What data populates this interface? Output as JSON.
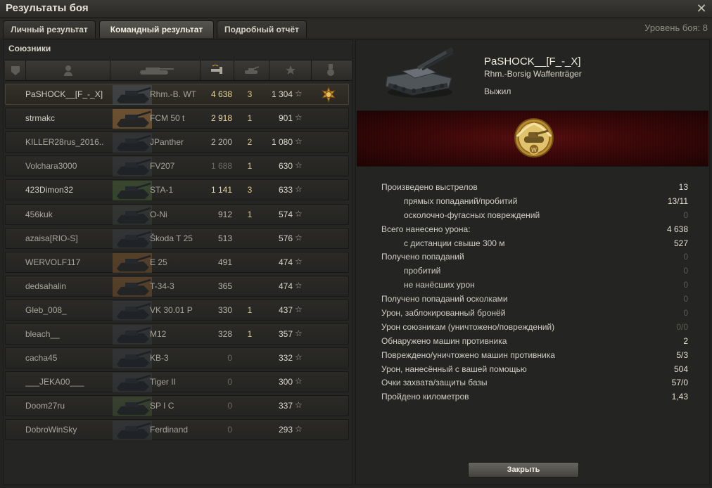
{
  "window": {
    "title": "Результаты боя",
    "close_icon": "close-icon"
  },
  "tabs": [
    {
      "label": "Личный результат",
      "active": false
    },
    {
      "label": "Командный результат",
      "active": true
    },
    {
      "label": "Подробный отчёт",
      "active": false
    }
  ],
  "battle_level": "Уровень боя: 8",
  "team": {
    "label": "Союзники",
    "header_icons": [
      "squad-icon",
      "player-icon",
      "vehicle-icon",
      "damage-icon",
      "frags-icon",
      "xp-star-icon",
      "medal-icon"
    ],
    "players": [
      {
        "name": "PaSHOCK__[F_-_X]",
        "vehicle": "Rhm.-B. WT",
        "damage": "4 638",
        "kills": "3",
        "xp": "1 304",
        "selected": true,
        "medal": true,
        "tank_color": "#525a66",
        "damage_level": "hi"
      },
      {
        "name": "strmakc",
        "vehicle": "FCM 50 t",
        "damage": "2 918",
        "kills": "1",
        "xp": "901",
        "tank_color": "#b7803f",
        "damage_level": "hi"
      },
      {
        "name": "KILLER28rus_2016..",
        "vehicle": "JPanther",
        "damage": "2 200",
        "kills": "2",
        "xp": "1 080",
        "tank_color": "#3b4048",
        "damage_level": "mid",
        "dim": true
      },
      {
        "name": "Volchara3000",
        "vehicle": "FV207",
        "damage": "1 688",
        "kills": "1",
        "xp": "630",
        "tank_color": "#3b4048",
        "damage_level": "lo",
        "dim": true
      },
      {
        "name": "423Dimon32",
        "vehicle": "STA-1",
        "damage": "1 141",
        "kills": "3",
        "xp": "633",
        "tank_color": "#4a6a3a",
        "damage_level": "hi"
      },
      {
        "name": "456kuk",
        "vehicle": "O-Ni",
        "damage": "912",
        "kills": "1",
        "xp": "574",
        "tank_color": "#3d4540",
        "damage_level": "mid",
        "dim": true
      },
      {
        "name": "azaisa[RIO-S]",
        "vehicle": "Škoda T 25",
        "damage": "513",
        "kills": "",
        "xp": "576",
        "tank_color": "#3b4048",
        "damage_level": "mid",
        "dim": true
      },
      {
        "name": "WERVOLF117",
        "vehicle": "E 25",
        "damage": "491",
        "kills": "",
        "xp": "474",
        "tank_color": "#8a5a2e",
        "damage_level": "mid",
        "dim": true
      },
      {
        "name": "dedsahalin",
        "vehicle": "T-34-3",
        "damage": "365",
        "kills": "",
        "xp": "474",
        "tank_color": "#8a5a2e",
        "damage_level": "mid",
        "dim": true
      },
      {
        "name": "Gleb_008_",
        "vehicle": "VK 30.01 P",
        "damage": "330",
        "kills": "1",
        "xp": "437",
        "tank_color": "#3b4048",
        "damage_level": "mid",
        "dim": true
      },
      {
        "name": "bleach__",
        "vehicle": "M12",
        "damage": "328",
        "kills": "1",
        "xp": "357",
        "tank_color": "#3b4048",
        "damage_level": "mid",
        "dim": true
      },
      {
        "name": "cacha45",
        "vehicle": "KB-3",
        "damage": "0",
        "kills": "",
        "xp": "332",
        "tank_color": "#3b4048",
        "damage_level": "lo",
        "dim": true
      },
      {
        "name": "___JEKA00___",
        "vehicle": "Tiger II",
        "damage": "0",
        "kills": "",
        "xp": "300",
        "tank_color": "#3b4048",
        "damage_level": "lo",
        "dim": true
      },
      {
        "name": "Doom27ru",
        "vehicle": "SP I C",
        "damage": "0",
        "kills": "",
        "xp": "337",
        "tank_color": "#4a5a3a",
        "damage_level": "lo",
        "dim": true
      },
      {
        "name": "DobroWinSky",
        "vehicle": "Ferdinand",
        "damage": "0",
        "kills": "",
        "xp": "293",
        "tank_color": "#3b4048",
        "damage_level": "lo",
        "dim": true
      }
    ]
  },
  "detail": {
    "player_name": "PaSHOCK__[F_-_X]",
    "vehicle_name": "Rhm.-Borsig Waffenträger",
    "status": "Выжил",
    "medal_icon": "high-caliber-medal-icon",
    "banner_color": "#4a0b0c",
    "stats": [
      {
        "label": "Произведено выстрелов",
        "value": "13",
        "indent": false
      },
      {
        "label": "прямых попаданий/пробитий",
        "value": "13/11",
        "indent": true
      },
      {
        "label": "осколочно-фугасных повреждений",
        "value": "0",
        "indent": true,
        "dim": true
      },
      {
        "label": "Всего нанесено урона:",
        "value": "4 638",
        "indent": false
      },
      {
        "label": "с дистанции свыше 300 м",
        "value": "527",
        "indent": true
      },
      {
        "label": "Получено попаданий",
        "value": "0",
        "indent": false,
        "dim": true
      },
      {
        "label": "пробитий",
        "value": "0",
        "indent": true,
        "dim": true
      },
      {
        "label": "не нанёсших урон",
        "value": "0",
        "indent": true,
        "dim": true
      },
      {
        "label": "Получено попаданий осколками",
        "value": "0",
        "indent": false,
        "dim": true
      },
      {
        "label": "Урон, заблокированный бронёй",
        "value": "0",
        "indent": false,
        "dim": true
      },
      {
        "label": "Урон союзникам (уничтожено/повреждений)",
        "value": "0/0",
        "indent": false,
        "dim": true
      },
      {
        "label": "Обнаружено машин противника",
        "value": "2",
        "indent": false
      },
      {
        "label": "Повреждено/уничтожено машин противника",
        "value": "5/3",
        "indent": false
      },
      {
        "label": "Урон, нанесённый с вашей помощью",
        "value": "504",
        "indent": false
      },
      {
        "label": "Очки захвата/защиты базы",
        "value": "57/0",
        "indent": false
      },
      {
        "label": "Пройдено километров",
        "value": "1,43",
        "indent": false
      }
    ],
    "close_button_label": "Закрыть"
  }
}
